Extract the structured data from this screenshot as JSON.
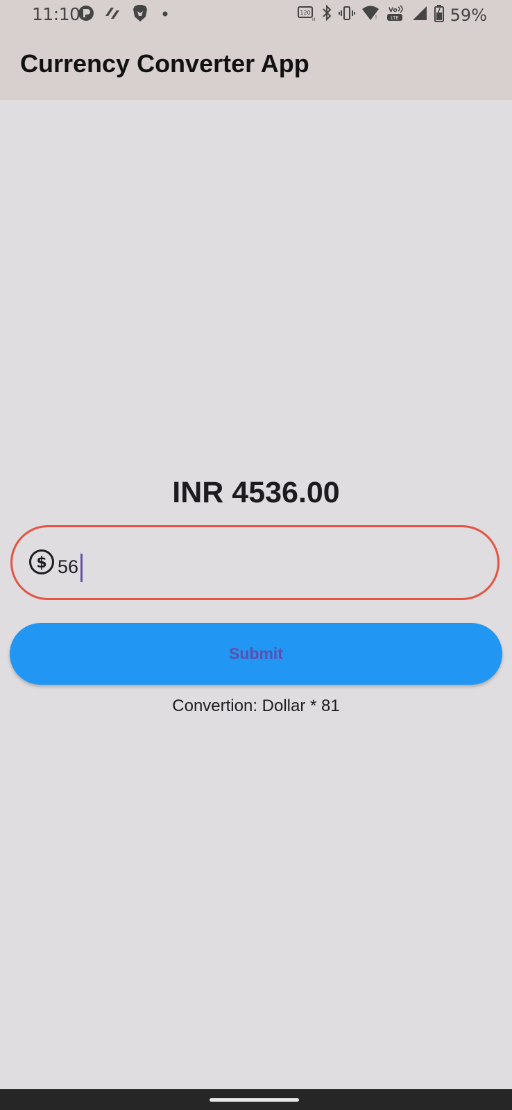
{
  "status_bar": {
    "time": "11:10",
    "battery": "59%",
    "left_icons": [
      "notification-app-icon",
      "app-icon",
      "brave-lion-icon",
      "dot-icon"
    ],
    "right_icons": [
      "refresh-rate-icon",
      "bluetooth-icon",
      "vibrate-icon",
      "wifi-icon",
      "volte-lte-icon",
      "signal-icon",
      "battery-icon"
    ]
  },
  "app_bar": {
    "title": "Currency Converter App"
  },
  "main": {
    "result": "INR 4536.00",
    "input": {
      "value": "56",
      "prefix_icon": "dollar-circle-icon",
      "border_color": "#e35443"
    },
    "submit_label": "Submit",
    "submit_color": "#2196f3",
    "conversion_note": "Convertion: Dollar * 81"
  }
}
